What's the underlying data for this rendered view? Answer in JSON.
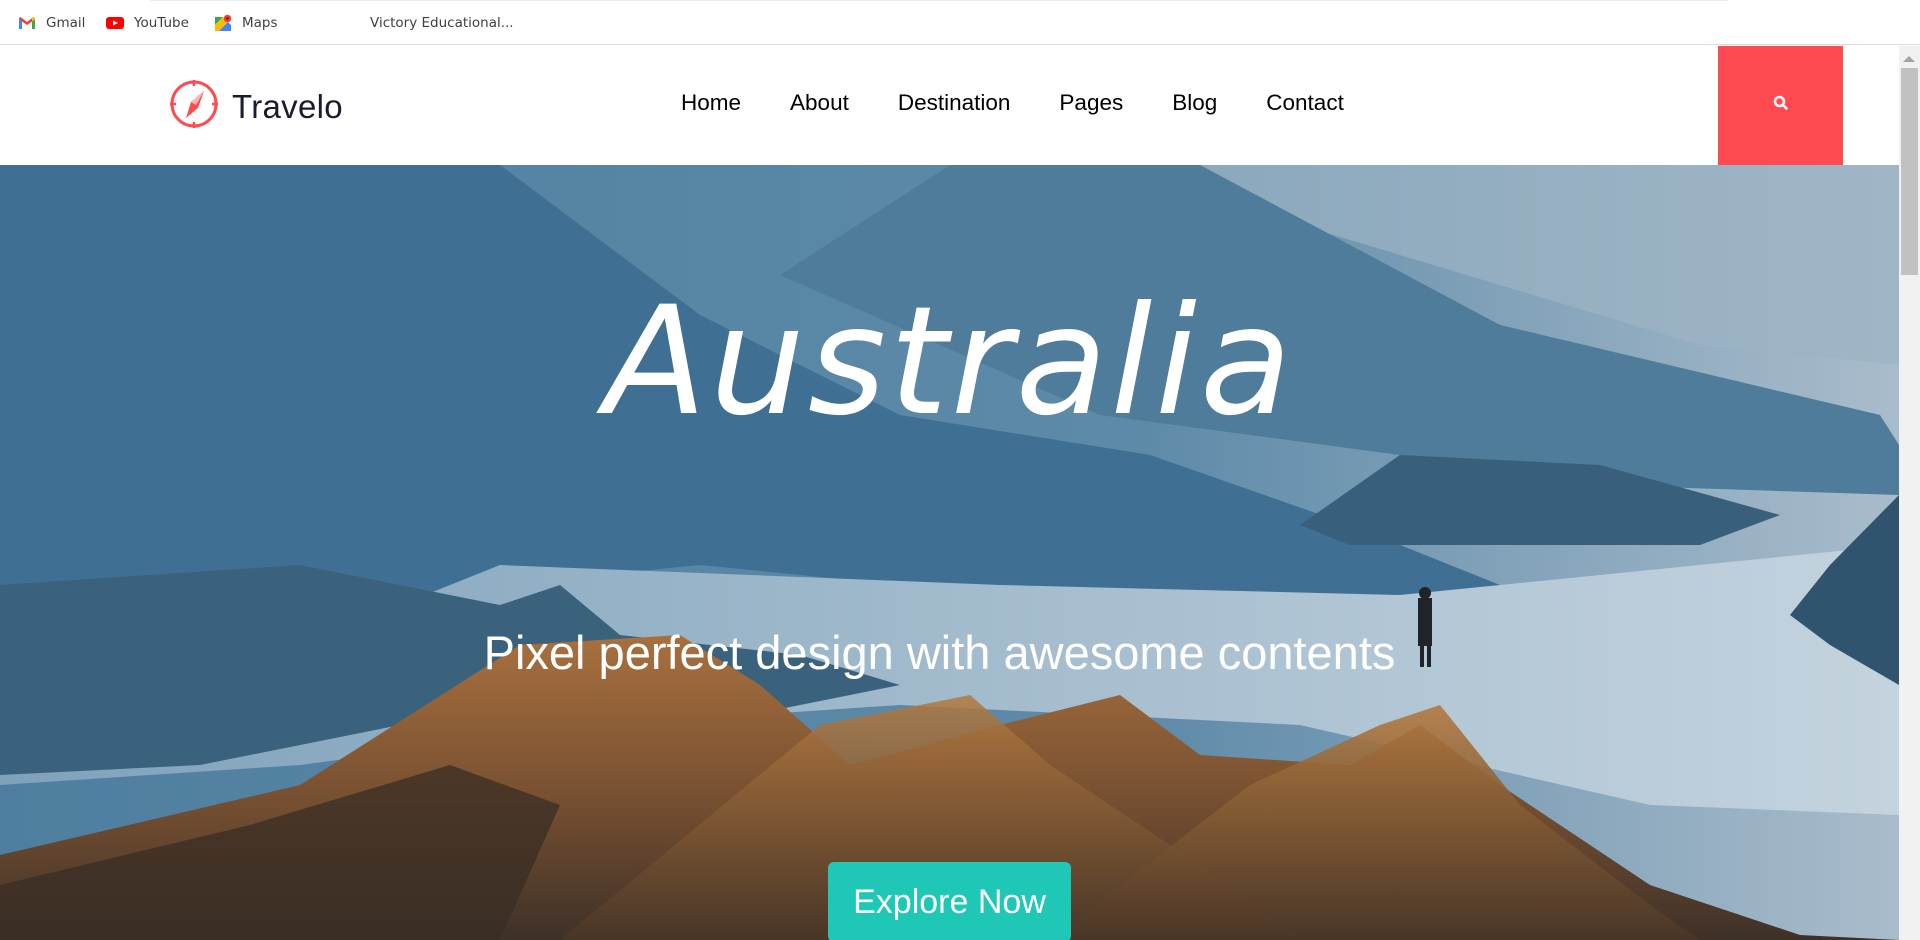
{
  "bookmarks": [
    {
      "label": "Gmail",
      "icon": "gmail-icon"
    },
    {
      "label": "YouTube",
      "icon": "youtube-icon"
    },
    {
      "label": "Maps",
      "icon": "maps-icon"
    },
    {
      "label": "",
      "icon": "globe-icon"
    },
    {
      "label": "Victory Educational...",
      "icon": "globe-icon"
    }
  ],
  "header": {
    "logo_text": "Travelo",
    "logo_icon": "compass-icon",
    "nav": [
      "Home",
      "About",
      "Destination",
      "Pages",
      "Blog",
      "Contact"
    ],
    "search_icon": "search-icon"
  },
  "hero": {
    "title": "Australia",
    "subtitle": "Pixel perfect design with awesome contents",
    "cta_label": "Explore Now"
  },
  "colors": {
    "accent_red": "#ff4a52",
    "cta_teal": "#1fc7b6",
    "logo_text": "#1b1b2f"
  }
}
